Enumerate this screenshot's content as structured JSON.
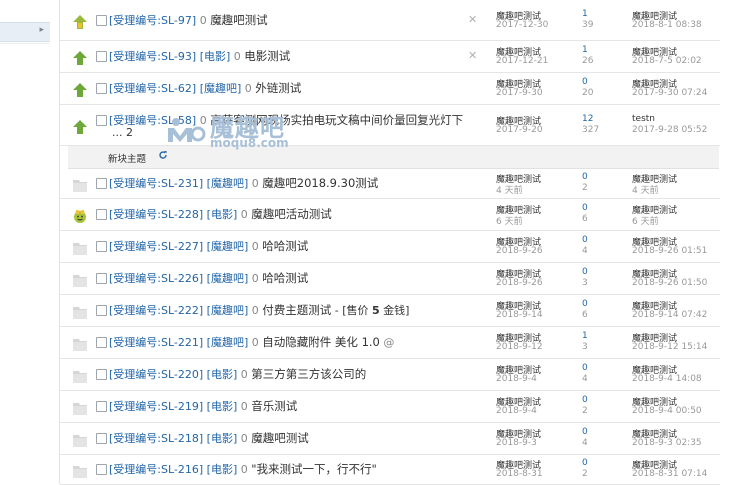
{
  "new_bar": {
    "label": "新块主题",
    "refresh_icon": "refresh-icon"
  },
  "watermark": {
    "name": "魔趣吧",
    "url": "moqu8.com"
  },
  "rows": [
    {
      "icon": "hot",
      "tag": "[受理编号:SL-97]",
      "rep": "0",
      "subj": "魔趣吧测试",
      "close": true,
      "author": "魔趣吧测试",
      "date": "2017-12-30",
      "replies": "1",
      "views": "39",
      "last_author": "魔趣吧测试",
      "last_date": "2018-8-1 08:38"
    },
    {
      "icon": "up",
      "tag": "[受理编号:SL-93]",
      "cat": "[电影]",
      "rep": "0",
      "subj": "电影测试",
      "close": true,
      "author": "魔趣吧测试",
      "date": "2017-12-21",
      "replies": "1",
      "views": "26",
      "last_author": "魔趣吧测试",
      "last_date": "2018-7-5 02:02"
    },
    {
      "icon": "up",
      "tag": "[受理编号:SL-62]",
      "cat": "[魔趣吧]",
      "rep": "0",
      "subj": "外链测试",
      "close": false,
      "author": "魔趣吧测试",
      "date": "2017-9-30",
      "replies": "0",
      "views": "20",
      "last_author": "魔趣吧测试",
      "last_date": "2017-9-30 07:24"
    },
    {
      "icon": "up",
      "tag": "[受理编号:SL-58]",
      "rep": "0",
      "subj": "高萨客测网现场实拍电玩文稿中间价量回复光灯下",
      "more": "... 2",
      "close": false,
      "author": "魔趣吧测试",
      "date": "2017-9-20",
      "replies": "12",
      "views": "327",
      "last_author": "testn",
      "last_date": "2017-9-28 05:52"
    },
    {
      "icon": "folder",
      "tag": "[受理编号:SL-231]",
      "cat": "[魔趣吧]",
      "rep": "0",
      "subj": "魔趣吧2018.9.30测试",
      "close": false,
      "author": "魔趣吧测试",
      "date": "4 天前",
      "replies": "0",
      "views": "2",
      "last_author": "魔趣吧测试",
      "last_date": "4 天前"
    },
    {
      "icon": "smile",
      "tag": "[受理编号:SL-228]",
      "cat": "[电影]",
      "rep": "0",
      "subj": "魔趣吧活动测试",
      "close": false,
      "author": "魔趣吧测试",
      "date": "6 天前",
      "replies": "0",
      "views": "6",
      "last_author": "魔趣吧测试",
      "last_date": "6 天前"
    },
    {
      "icon": "folder",
      "tag": "[受理编号:SL-227]",
      "cat": "[魔趣吧]",
      "rep": "0",
      "subj": "哈哈测试",
      "close": false,
      "author": "魔趣吧测试",
      "date": "2018-9-26",
      "replies": "0",
      "views": "4",
      "last_author": "魔趣吧测试",
      "last_date": "2018-9-26 01:51"
    },
    {
      "icon": "folder",
      "tag": "[受理编号:SL-226]",
      "cat": "[魔趣吧]",
      "rep": "0",
      "subj": "哈哈测试",
      "close": false,
      "author": "魔趣吧测试",
      "date": "2018-9-26",
      "replies": "0",
      "views": "3",
      "last_author": "魔趣吧测试",
      "last_date": "2018-9-26 01:50"
    },
    {
      "icon": "folder",
      "tag": "[受理编号:SL-222]",
      "cat": "[魔趣吧]",
      "rep": "0",
      "subj": "付费主题测试",
      "price_pre": " - [售价 ",
      "price_num": "5",
      "price_post": " 金钱]",
      "close": false,
      "author": "魔趣吧测试",
      "date": "2018-9-14",
      "replies": "0",
      "views": "6",
      "last_author": "魔趣吧测试",
      "last_date": "2018-9-14 07:42"
    },
    {
      "icon": "folder",
      "tag": "[受理编号:SL-221]",
      "cat": "[魔趣吧]",
      "rep": "0",
      "subj": "自动隐藏附件 美化 1.0",
      "attach": "@",
      "close": false,
      "author": "魔趣吧测试",
      "date": "2018-9-12",
      "replies": "1",
      "views": "3",
      "last_author": "魔趣吧测试",
      "last_date": "2018-9-12 15:14"
    },
    {
      "icon": "folder",
      "tag": "[受理编号:SL-220]",
      "cat": "[电影]",
      "rep": "0",
      "subj": "第三方第三方该公司的",
      "close": false,
      "author": "魔趣吧测试",
      "date": "2018-9-4",
      "replies": "0",
      "views": "4",
      "last_author": "魔趣吧测试",
      "last_date": "2018-9-4 14:08"
    },
    {
      "icon": "folder",
      "tag": "[受理编号:SL-219]",
      "cat": "[电影]",
      "rep": "0",
      "subj": "音乐测试",
      "close": false,
      "author": "魔趣吧测试",
      "date": "2018-9-4",
      "replies": "0",
      "views": "2",
      "last_author": "魔趣吧测试",
      "last_date": "2018-9-4 00:50"
    },
    {
      "icon": "folder",
      "tag": "[受理编号:SL-218]",
      "cat": "[电影]",
      "rep": "0",
      "subj": "魔趣吧测试",
      "close": false,
      "author": "魔趣吧测试",
      "date": "2018-9-3",
      "replies": "0",
      "views": "4",
      "last_author": "魔趣吧测试",
      "last_date": "2018-9-3 02:35"
    },
    {
      "icon": "folder",
      "tag": "[受理编号:SL-216]",
      "cat": "[电影]",
      "rep": "0",
      "subj": "\"我来测试一下，行不行\"",
      "close": false,
      "author": "魔趣吧测试",
      "date": "2018-8-31",
      "replies": "0",
      "views": "2",
      "last_author": "魔趣吧测试",
      "last_date": "2018-8-31 07:14"
    }
  ]
}
